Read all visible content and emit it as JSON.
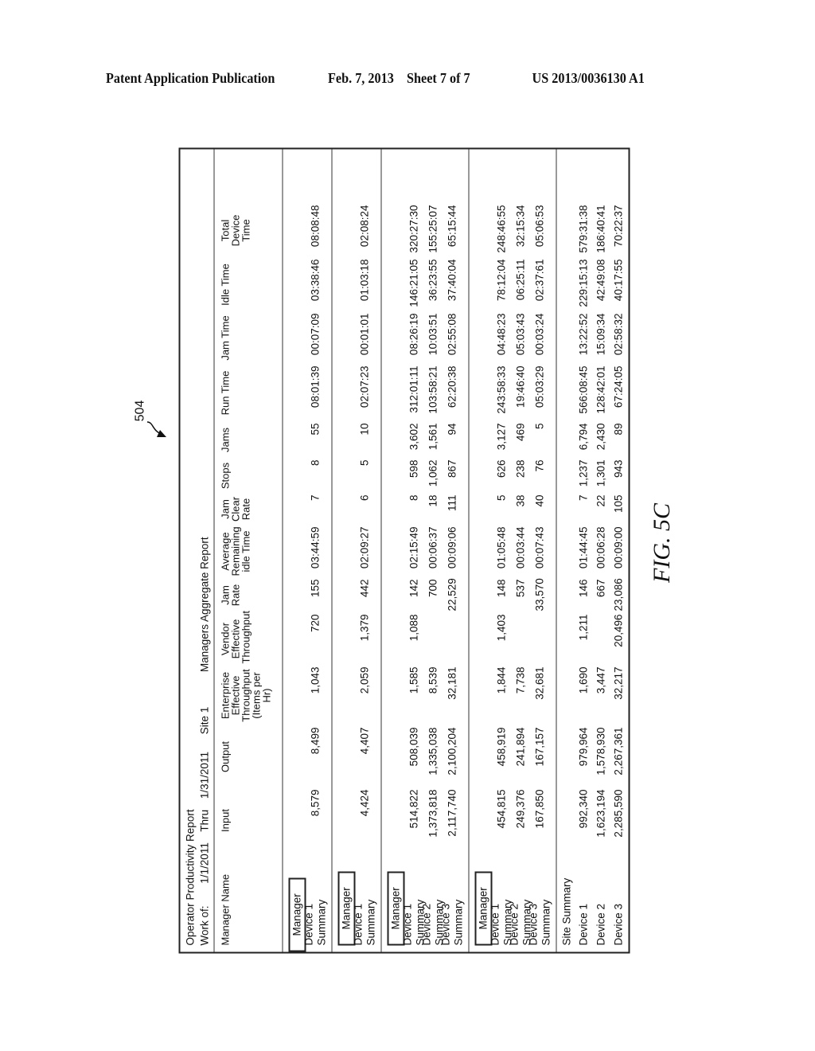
{
  "publication": {
    "left": "Patent Application Publication",
    "middle": "Feb. 7, 2013    Sheet 7 of 7",
    "right": "US 2013/0036130 A1"
  },
  "reference_numeral": "504",
  "figure_caption": "FIG. 5C",
  "report": {
    "title": "Operator Productivity Report",
    "work_of_label": "Work of:",
    "start_date": "1/1/2011",
    "thru_label": "Thru",
    "end_date": "1/31/2011",
    "site": "Site 1",
    "report_name": "Managers Aggregate Report",
    "columns": [
      "Manager Name",
      "Input",
      "Output",
      "Enterprise Effective Throughput (Items per Hr)",
      "Vendor Effective Throughput",
      "Jam Rate",
      "Average Remaining idle Time",
      "Jam Clear Rate",
      "Stops",
      "Jams",
      "Run Time",
      "Jam Time",
      "Idle Time",
      "Total Device Time"
    ],
    "manager_label": "Manager",
    "groups": [
      {
        "rows": [
          [
            "Device 1 Summary",
            "8,579",
            "8,499",
            "1,043",
            "720",
            "155",
            "03:44:59",
            "7",
            "8",
            "55",
            "08:01:39",
            "00:07:09",
            "03:38:46",
            "08:08:48"
          ]
        ]
      },
      {
        "rows": [
          [
            "Device 1 Summary",
            "4,424",
            "4,407",
            "2,059",
            "1,379",
            "442",
            "02:09:27",
            "6",
            "5",
            "10",
            "02:07:23",
            "00:01:01",
            "01:03:18",
            "02:08:24"
          ]
        ]
      },
      {
        "rows": [
          [
            "Device 1 Summary",
            "514,822",
            "508,039",
            "1,585",
            "1,088",
            "142",
            "02:15:49",
            "8",
            "598",
            "3,602",
            "312:01:11",
            "08:26:19",
            "146:21:05",
            "320:27:30"
          ],
          [
            "Device 2 Summary",
            "1,373,818",
            "1,335,038",
            "8,539",
            "",
            "700",
            "00:06:37",
            "18",
            "1,062",
            "1,561",
            "103:58:21",
            "10:03:51",
            "36:23:55",
            "155:25:07"
          ],
          [
            "Device 3 Summary",
            "2,117,740",
            "2,100,204",
            "32,181",
            "",
            "22,529",
            "00:09:06",
            "111",
            "867",
            "94",
            "62:20:38",
            "02:55:08",
            "37:40:04",
            "65:15:44"
          ]
        ]
      },
      {
        "rows": [
          [
            "Device 1 Summary",
            "454,815",
            "458,919",
            "1,844",
            "1,403",
            "148",
            "01:05:48",
            "5",
            "626",
            "3,127",
            "243:58:33",
            "04:48:23",
            "78:12:04",
            "248:46:55"
          ],
          [
            "Device 2 Summary",
            "249,376",
            "241,894",
            "7,738",
            "",
            "537",
            "00:03:44",
            "38",
            "238",
            "469",
            "19:46:40",
            "05:03:43",
            "06:25:11",
            "32:15:34"
          ],
          [
            "Device 3 Summary",
            "167,850",
            "167,157",
            "32,681",
            "",
            "33,570",
            "00:07:43",
            "40",
            "76",
            "5",
            "05:03:29",
            "00:03:24",
            "02:37:61",
            "05:06:53"
          ]
        ]
      }
    ],
    "site_summary": {
      "title": "Site Summary",
      "rows": [
        [
          "Device 1",
          "992,340",
          "979,964",
          "1,690",
          "1,211",
          "146",
          "01:44:45",
          "7",
          "1,237",
          "6,794",
          "566:08:45",
          "13:22:52",
          "229:15:13",
          "579:31:38"
        ],
        [
          "Device 2",
          "1,623,194",
          "1,578,930",
          "3,447",
          "",
          "667",
          "00:06:28",
          "22",
          "1,301",
          "2,430",
          "128:42:01",
          "15:09:34",
          "42:49:08",
          "186:40:41"
        ],
        [
          "Device 3",
          "2,285,590",
          "2,267,361",
          "32,217",
          "20,496",
          "23,086",
          "00:09:00",
          "105",
          "943",
          "89",
          "67:24:05",
          "02:58:32",
          "40:17:55",
          "70:22:37"
        ]
      ]
    }
  }
}
